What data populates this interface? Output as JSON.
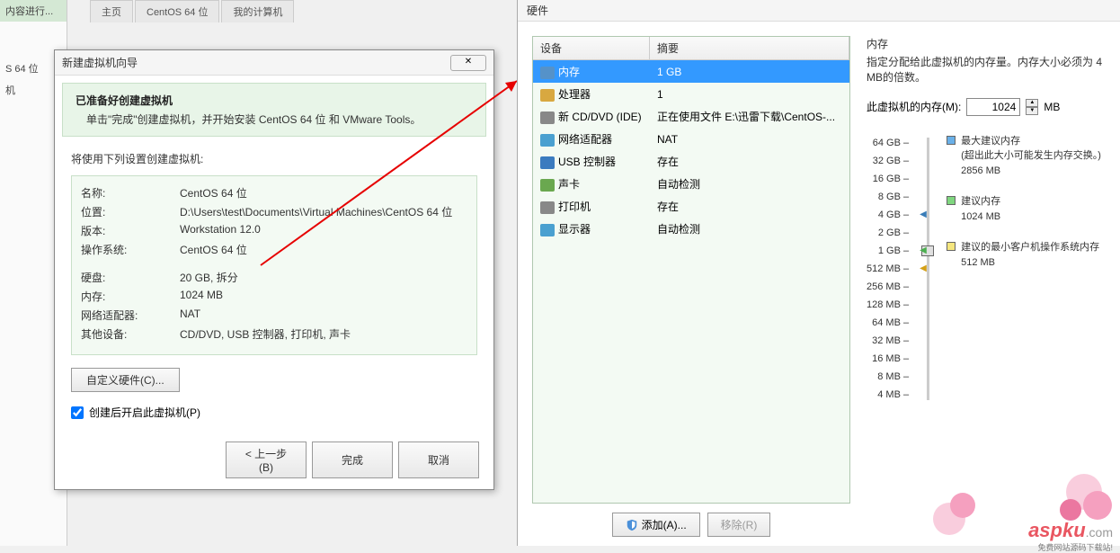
{
  "bg_tabs": [
    "主页",
    "CentOS 64 位",
    "我的计算机"
  ],
  "left_sidebar": {
    "item1": "内容进行...",
    "item2": "S 64 位",
    "item3": "机"
  },
  "wizard": {
    "title": "新建虚拟机向导",
    "header_title": "已准备好创建虚拟机",
    "header_sub": "单击\"完成\"创建虚拟机，并开始安装 CentOS 64 位 和 VMware Tools。",
    "use_settings": "将使用下列设置创建虚拟机:",
    "rows": {
      "name_label": "名称:",
      "name_value": "CentOS 64 位",
      "location_label": "位置:",
      "location_value": "D:\\Users\\test\\Documents\\Virtual Machines\\CentOS 64 位",
      "version_label": "版本:",
      "version_value": "Workstation 12.0",
      "os_label": "操作系统:",
      "os_value": "CentOS 64 位",
      "disk_label": "硬盘:",
      "disk_value": "20 GB, 拆分",
      "mem_label": "内存:",
      "mem_value": "1024 MB",
      "net_label": "网络适配器:",
      "net_value": "NAT",
      "other_label": "其他设备:",
      "other_value": "CD/DVD, USB 控制器, 打印机, 声卡"
    },
    "customize_btn": "自定义硬件(C)...",
    "checkbox_label": "创建后开启此虚拟机(P)",
    "btn_back": "< 上一步(B)",
    "btn_finish": "完成",
    "btn_cancel": "取消"
  },
  "hardware": {
    "title": "硬件",
    "col_device": "设备",
    "col_summary": "摘要",
    "devices": [
      {
        "icon": "memory-icon",
        "name": "内存",
        "summary": "1 GB",
        "selected": true
      },
      {
        "icon": "cpu-icon",
        "name": "处理器",
        "summary": "1"
      },
      {
        "icon": "cd-icon",
        "name": "新 CD/DVD (IDE)",
        "summary": "正在使用文件 E:\\迅雷下载\\CentOS-..."
      },
      {
        "icon": "network-icon",
        "name": "网络适配器",
        "summary": "NAT"
      },
      {
        "icon": "usb-icon",
        "name": "USB 控制器",
        "summary": "存在"
      },
      {
        "icon": "sound-icon",
        "name": "声卡",
        "summary": "自动检测"
      },
      {
        "icon": "printer-icon",
        "name": "打印机",
        "summary": "存在"
      },
      {
        "icon": "display-icon",
        "name": "显示器",
        "summary": "自动检测"
      }
    ],
    "btn_add": "添加(A)...",
    "btn_remove": "移除(R)",
    "mem_title": "内存",
    "mem_desc": "指定分配给此虚拟机的内存量。内存大小必须为 4 MB的倍数。",
    "mem_field_label": "此虚拟机的内存(M):",
    "mem_value": "1024",
    "mem_unit": "MB",
    "ticks": [
      "64 GB",
      "32 GB",
      "16 GB",
      "8 GB",
      "4 GB",
      "2 GB",
      "1 GB",
      "512 MB",
      "256 MB",
      "128 MB",
      "64 MB",
      "32 MB",
      "16 MB",
      "8 MB",
      "4 MB"
    ],
    "legend": {
      "max_title": "最大建议内存",
      "max_desc": "(超出此大小可能发生内存交换。)",
      "max_val": "2856 MB",
      "rec_title": "建议内存",
      "rec_val": "1024 MB",
      "min_title": "建议的最小客户机操作系统内存",
      "min_val": "512 MB"
    }
  },
  "watermark": {
    "brand": "aspku",
    "suffix": ".com",
    "tagline": "免费网站源码下载站!"
  }
}
